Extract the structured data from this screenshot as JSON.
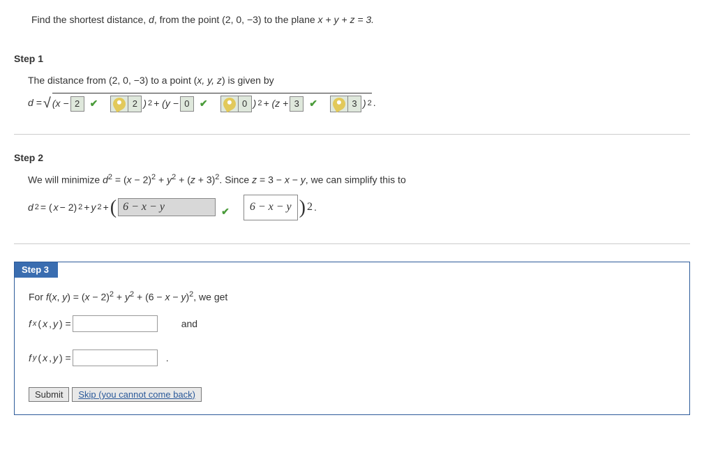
{
  "prompt": {
    "pre": "Find the shortest distance, ",
    "var": "d",
    "mid": ", from the point (2, 0, −3) to the plane ",
    "eqn": "x + y + z = 3."
  },
  "step1": {
    "label": "Step 1",
    "lead": "The distance from (2, 0, −3) to a point (",
    "xyz": "x, y, z",
    "lead2": ") is given by",
    "eq_prefix": "d = ",
    "x_open": "(x − ",
    "ans1": "2",
    "key1": "2",
    "close_sq": " )",
    "y_open": " + (y − ",
    "ans2": "0",
    "key2": "0",
    "z_open": " + (z + ",
    "ans3": "3",
    "key3": "3",
    "final": " )",
    "dot": "."
  },
  "step2": {
    "label": "Step 2",
    "text1_a": "We will minimize ",
    "text1_b": " = (",
    "text1_c": " − 2)",
    "text1_d": " + ",
    "text1_e": " + (",
    "text1_f": " + 3)",
    "text1_g": ". Since ",
    "text1_h": " = 3 − ",
    "text1_i": " − ",
    "text1_j": ", we can simplify this to",
    "eq2_a": " = (",
    "eq2_b": " − 2)",
    "eq2_c": " + ",
    "eq2_d": " + ",
    "input_val": "6 − x − y",
    "display_val": "6 − x − y",
    "dot": "."
  },
  "step3": {
    "label": "Step 3",
    "text_a": "For ",
    "text_b": "(",
    "text_c": ", ",
    "text_d": ") = (",
    "text_e": " − 2)",
    "text_f": " + ",
    "text_g": " + (6 − ",
    "text_h": " − ",
    "text_i": ")",
    "text_j": ", we get",
    "fx_a": "(",
    "fx_b": ", ",
    "fx_c": ")  = ",
    "and": " and",
    "fy_c": ")  = ",
    "dot": ".",
    "submit": "Submit",
    "skip": "Skip (you cannot come back)"
  }
}
